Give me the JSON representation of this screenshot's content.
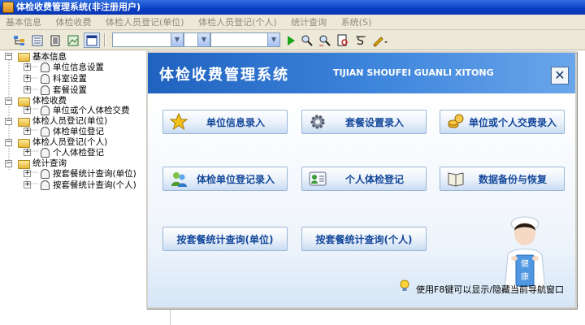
{
  "window": {
    "title": "体检收费管理系统(非注册用户)"
  },
  "menubar": [
    "基本信息",
    "体检收费",
    "体检人员登记(单位)",
    "体检人员登记(个人)",
    "统计查询",
    "系统(S)"
  ],
  "toolbar": {
    "buttons": [
      "tree-view-icon",
      "list-view-icon",
      "document-icon",
      "image-icon",
      "window-icon"
    ],
    "combos": [
      "",
      "",
      ""
    ],
    "actions": [
      "run-icon",
      "find-icon",
      "find-next-icon",
      "report-icon",
      "clear-icon",
      "edit-icon"
    ]
  },
  "tree": [
    {
      "label": "基本信息",
      "level": 0,
      "children": [
        "单位信息设置",
        "科室设置",
        "套餐设置"
      ]
    },
    {
      "label": "体检收费",
      "level": 0,
      "children": [
        "单位或个人体检交费"
      ]
    },
    {
      "label": "体检人员登记(单位)",
      "level": 0,
      "children": [
        "体检单位登记"
      ]
    },
    {
      "label": "体检人员登记(个人)",
      "level": 0,
      "children": [
        "个人体检登记"
      ]
    },
    {
      "label": "统计查询",
      "level": 0,
      "children": [
        "按套餐统计查询(单位)",
        "按套餐统计查询(个人)"
      ]
    }
  ],
  "panel": {
    "title": "体检收费管理系统",
    "subtitle": "TIJIAN SHOUFEI GUANLI XITONG",
    "close": "✕",
    "buttons": [
      {
        "label": "单位信息录入",
        "icon": "star-icon"
      },
      {
        "label": "套餐设置录入",
        "icon": "gear-icon"
      },
      {
        "label": "单位或个人交费录入",
        "icon": "coins-icon"
      },
      {
        "label": "体检单位登记录入",
        "icon": "users-icon"
      },
      {
        "label": "个人体检登记",
        "icon": "id-card-icon"
      },
      {
        "label": "数据备份与恢复",
        "icon": "book-icon"
      },
      {
        "label": "按套餐统计查询(单位)",
        "icon": ""
      },
      {
        "label": "按套餐统计查询(个人)",
        "icon": ""
      }
    ],
    "hint": "使用F8键可以显示/隐藏当前导航窗口",
    "sign_text": [
      "健",
      "康"
    ]
  },
  "colors": {
    "title_blue": "#0a3fc4",
    "header_blue": "#1f62bf",
    "button_text": "#14489b",
    "panel_bg": "#dce8f6"
  }
}
